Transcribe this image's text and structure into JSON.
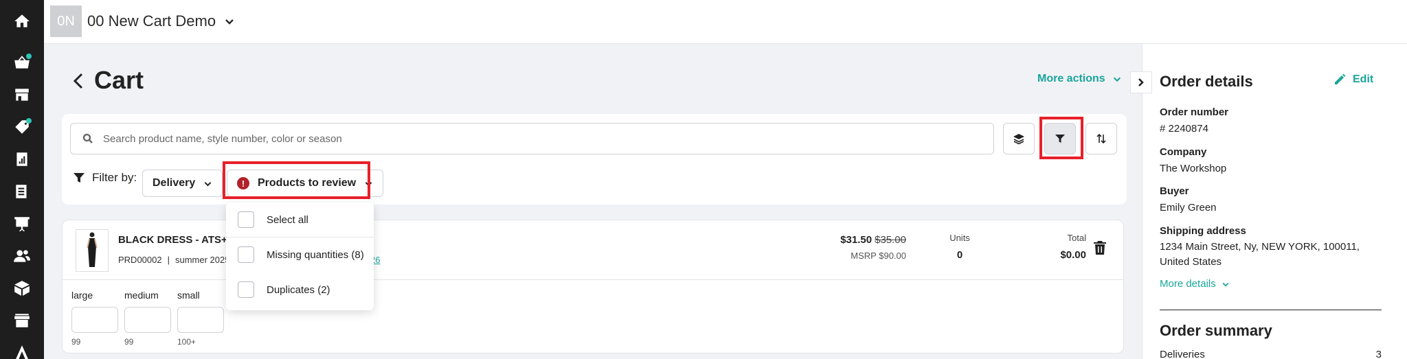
{
  "app": {
    "avatar_initials": "0N",
    "title": "00 New Cart Demo"
  },
  "nav": {
    "items": [
      {
        "name": "home",
        "icon": "home-icon"
      },
      {
        "name": "cart",
        "icon": "basket-icon",
        "badge": true
      },
      {
        "name": "store",
        "icon": "storefront-icon"
      },
      {
        "name": "tags",
        "icon": "tag-icon",
        "badge": true
      },
      {
        "name": "reports",
        "icon": "report-icon"
      },
      {
        "name": "catalog",
        "icon": "book-icon"
      },
      {
        "name": "presentations",
        "icon": "presentation-icon"
      },
      {
        "name": "customers",
        "icon": "users-icon"
      },
      {
        "name": "products",
        "icon": "box-icon"
      },
      {
        "name": "shops",
        "icon": "shop-icon"
      },
      {
        "name": "brand",
        "icon": "brand-icon"
      }
    ]
  },
  "page": {
    "title": "Cart",
    "more_actions": "More actions"
  },
  "search": {
    "placeholder": "Search product name, style number, color or season"
  },
  "filters": {
    "label": "Filter by:",
    "delivery": "Delivery",
    "review": "Products to review",
    "review_icon": "!",
    "options": [
      "Select all",
      "Missing quantities (8)",
      "Duplicates (2)"
    ]
  },
  "product": {
    "name": "BLACK DRESS - ATS+FU",
    "code": "PRD00002",
    "separator": "|",
    "season": "summer 2025",
    "link_fragment": "26",
    "price": "$31.50",
    "old_price": "$35.00",
    "msrp": "MSRP $90.00",
    "units_label": "Units",
    "units_value": "0",
    "total_label": "Total",
    "total_value": "$0.00",
    "sizes": [
      {
        "label": "large",
        "stock": "99"
      },
      {
        "label": "medium",
        "stock": "99"
      },
      {
        "label": "small",
        "stock": "100+"
      }
    ]
  },
  "order": {
    "title": "Order details",
    "edit": "Edit",
    "number_label": "Order number",
    "number_value": "# 2240874",
    "company_label": "Company",
    "company_value": "The Workshop",
    "buyer_label": "Buyer",
    "buyer_value": "Emily Green",
    "shipping_label": "Shipping address",
    "shipping_value": "1234 Main Street, Ny, NEW YORK, 100011, United States",
    "more_details": "More details",
    "summary_title": "Order summary",
    "deliveries_label": "Deliveries",
    "deliveries_value": "3"
  },
  "colors": {
    "accent": "#1aa59a",
    "highlight": "#e8202a",
    "warning": "#b3222a",
    "nav_bg": "#1e1e1e"
  }
}
